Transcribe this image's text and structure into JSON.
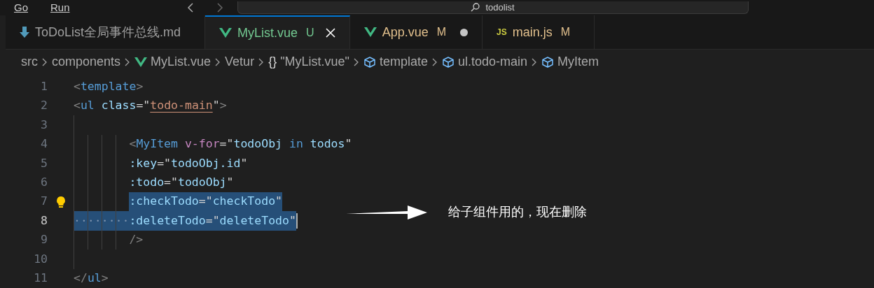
{
  "menu": [
    "Go",
    "Run"
  ],
  "search": {
    "value": "todolist"
  },
  "tabs": [
    {
      "kind": "markdown",
      "label": "ToDoList全局事件总线.md",
      "selected": false,
      "color": "#a0a0a0",
      "dot": false,
      "close": false
    },
    {
      "kind": "vue",
      "label": "MyList.vue",
      "selected": true,
      "color": "#73c991",
      "status": "U",
      "dot": false,
      "close": true
    },
    {
      "kind": "vue",
      "label": "App.vue",
      "selected": false,
      "color": "#e2c08d",
      "status": "M",
      "dot": true,
      "close": false
    },
    {
      "kind": "js",
      "label": "main.js",
      "selected": false,
      "color": "#e2c08d",
      "status": "M",
      "dot": false,
      "close": false,
      "icon_text": "JS"
    }
  ],
  "breadcrumbs": [
    {
      "kind": "folder",
      "label": "src"
    },
    {
      "kind": "folder",
      "label": "components"
    },
    {
      "kind": "vue",
      "label": "MyList.vue"
    },
    {
      "kind": "plain",
      "label": "Vetur"
    },
    {
      "kind": "braces",
      "label": "\"MyList.vue\"",
      "icon_text": "{}"
    },
    {
      "kind": "cube",
      "label": "template"
    },
    {
      "kind": "cube",
      "label": "ul.todo-main"
    },
    {
      "kind": "cube",
      "label": "MyItem"
    }
  ],
  "code": [
    {
      "number": "1",
      "kind": "top",
      "current": false,
      "lightbulb": false,
      "selected": false,
      "tokens": [
        {
          "kind": "punct",
          "text": "<",
          "selected": false
        },
        {
          "kind": "tag",
          "text": "template",
          "selected": false
        },
        {
          "kind": "punct",
          "text": ">",
          "selected": false
        }
      ]
    },
    {
      "number": "2",
      "kind": "top",
      "current": false,
      "lightbulb": false,
      "selected": false,
      "tokens": [
        {
          "kind": "punct",
          "text": "<",
          "selected": false
        },
        {
          "kind": "tag",
          "text": "ul",
          "selected": false
        },
        {
          "kind": "attr",
          "text": " class",
          "selected": false
        },
        {
          "kind": "text",
          "text": "=\"",
          "selected": false
        },
        {
          "kind": "string",
          "text": "todo-main",
          "selected": false
        },
        {
          "kind": "text",
          "text": "\"",
          "selected": false
        },
        {
          "kind": "punct",
          "text": ">",
          "selected": false
        }
      ]
    },
    {
      "number": "3",
      "kind": "blank",
      "current": false,
      "lightbulb": false,
      "selected": false
    },
    {
      "number": "4",
      "kind": "nested",
      "current": false,
      "lightbulb": false,
      "selected": false,
      "tokens": [
        {
          "kind": "punct",
          "text": "<",
          "selected": false
        },
        {
          "kind": "tag",
          "text": "MyItem",
          "selected": false
        },
        {
          "kind": "directive",
          "text": " v-for",
          "selected": false
        },
        {
          "kind": "text",
          "text": "=\"",
          "selected": false
        },
        {
          "kind": "var",
          "text": "todoObj",
          "selected": false
        },
        {
          "kind": "keyword",
          "text": " in",
          "selected": false
        },
        {
          "kind": "var",
          "text": " todos",
          "selected": false
        },
        {
          "kind": "text",
          "text": "\"",
          "selected": false
        }
      ]
    },
    {
      "number": "5",
      "kind": "nested",
      "current": false,
      "lightbulb": false,
      "selected": false,
      "tokens": [
        {
          "kind": "attr",
          "text": ":key",
          "selected": false
        },
        {
          "kind": "text",
          "text": "=\"",
          "selected": false
        },
        {
          "kind": "var",
          "text": "todoObj.id",
          "selected": false
        },
        {
          "kind": "text",
          "text": "\"",
          "selected": false
        }
      ]
    },
    {
      "number": "6",
      "kind": "nested",
      "current": false,
      "lightbulb": false,
      "selected": false,
      "tokens": [
        {
          "kind": "attr",
          "text": ":todo",
          "selected": false
        },
        {
          "kind": "text",
          "text": "=\"",
          "selected": false
        },
        {
          "kind": "var",
          "text": "todoObj",
          "selected": false
        },
        {
          "kind": "text",
          "text": "\"",
          "selected": false
        }
      ]
    },
    {
      "number": "7",
      "kind": "nested",
      "current": false,
      "lightbulb": true,
      "selected": false,
      "tokens": [
        {
          "kind": "attr",
          "text": ":checkTodo",
          "selected": true
        },
        {
          "kind": "text",
          "text": "=\"",
          "selected": true
        },
        {
          "kind": "var",
          "text": "checkTodo",
          "selected": true
        },
        {
          "kind": "text",
          "text": "\"",
          "selected": true
        }
      ]
    },
    {
      "number": "8",
      "kind": "nested",
      "current": true,
      "lightbulb": false,
      "selected": true,
      "tokens": [
        {
          "kind": "attr",
          "text": ":deleteTodo",
          "selected": true
        },
        {
          "kind": "text",
          "text": "=\"",
          "selected": true
        },
        {
          "kind": "var",
          "text": "deleteTodo",
          "selected": true
        },
        {
          "kind": "text",
          "text": "\"",
          "selected": true
        }
      ]
    },
    {
      "number": "9",
      "kind": "nested",
      "current": false,
      "lightbulb": false,
      "selected": false,
      "tokens": [
        {
          "kind": "punct",
          "text": "/>",
          "selected": false
        }
      ]
    },
    {
      "number": "10",
      "kind": "blank",
      "current": false,
      "lightbulb": false,
      "selected": false
    },
    {
      "number": "11",
      "kind": "top",
      "current": false,
      "lightbulb": false,
      "selected": false,
      "tokens": [
        {
          "kind": "punct",
          "text": "</",
          "selected": false
        },
        {
          "kind": "tag",
          "text": "ul",
          "selected": false
        },
        {
          "kind": "punct",
          "text": ">",
          "selected": false
        }
      ]
    }
  ],
  "annotation": {
    "text": "给子组件用的，现在删除"
  }
}
